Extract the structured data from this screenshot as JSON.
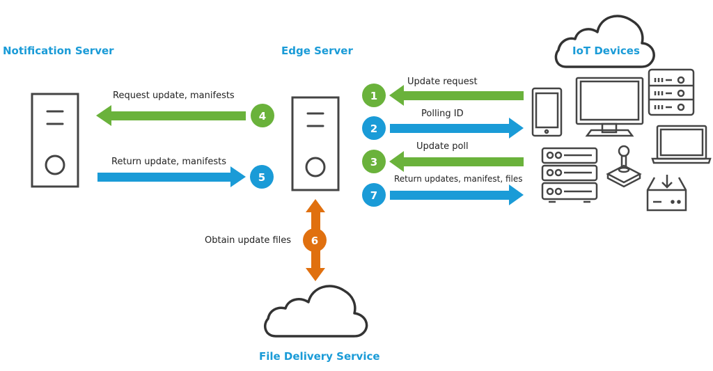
{
  "titles": {
    "notification_server": "Notification  Server",
    "edge_server": "Edge Server",
    "iot_devices": "IoT Devices",
    "file_delivery": "File Delivery Service"
  },
  "colors": {
    "title_blue": "#1a9bd7",
    "green": "#6ab23b",
    "blue": "#1a9bd7",
    "orange": "#e0700f",
    "stroke": "#444444"
  },
  "steps": [
    {
      "num": "1",
      "label": "Update request",
      "direction": "left",
      "color": "green"
    },
    {
      "num": "2",
      "label": "Polling ID",
      "direction": "right",
      "color": "blue"
    },
    {
      "num": "3",
      "label": "Update poll",
      "direction": "left",
      "color": "green"
    },
    {
      "num": "4",
      "label": "Request update, manifests",
      "direction": "left",
      "color": "green"
    },
    {
      "num": "5",
      "label": "Return update, manifests",
      "direction": "right",
      "color": "blue"
    },
    {
      "num": "6",
      "label": "Obtain update files",
      "direction": "both",
      "color": "orange"
    },
    {
      "num": "7",
      "label": "Return updates, manifest, files",
      "direction": "right",
      "color": "blue"
    }
  ],
  "devices": [
    "phone-icon",
    "monitor-icon",
    "rack-server-icon",
    "laptop-icon",
    "server-stack-icon",
    "joystick-icon",
    "download-drive-icon"
  ]
}
